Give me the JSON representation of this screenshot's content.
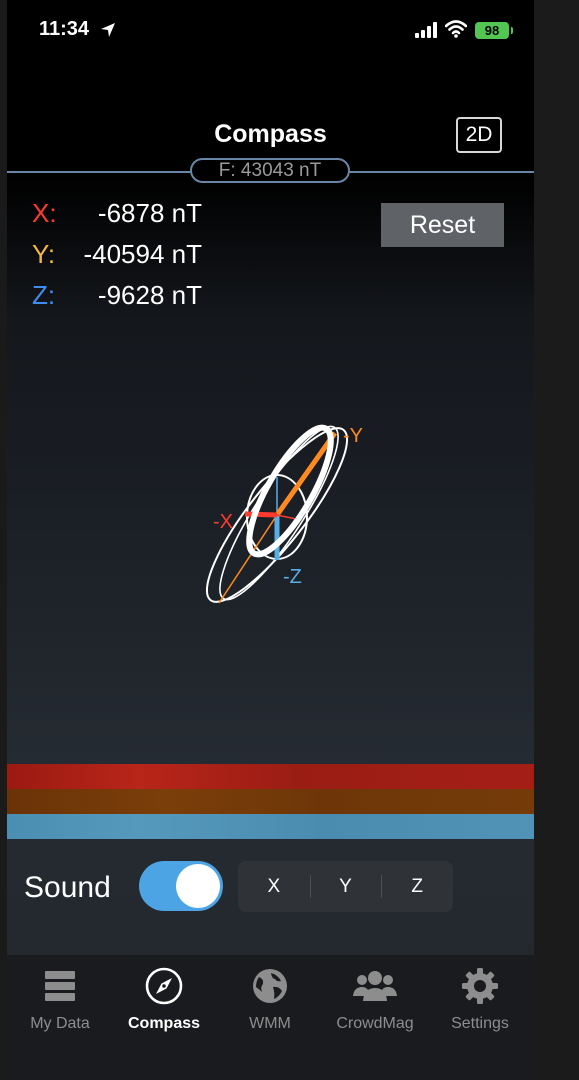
{
  "status": {
    "time": "11:34",
    "battery": "98"
  },
  "header": {
    "title": "Compass",
    "mode_button": "2D",
    "field_total": "F: 43043 nT"
  },
  "readings": [
    {
      "axis": "X:",
      "value": "-6878 nT",
      "color": "#ff3b30"
    },
    {
      "axis": "Y:",
      "value": "-40594 nT",
      "color": "#f5b83d"
    },
    {
      "axis": "Z:",
      "value": "-9628 nT",
      "color": "#3d8ef0"
    }
  ],
  "reset_button": "Reset",
  "viz": {
    "x_label": "-X",
    "y_label": "-Y",
    "z_label": "-Z",
    "x_color": "#ff3b30",
    "y_color": "#ff8a1f",
    "z_color": "#5aaee6"
  },
  "sound": {
    "label": "Sound",
    "enabled": true,
    "axes": [
      "X",
      "Y",
      "Z"
    ]
  },
  "tabs": [
    {
      "label": "My Data",
      "icon": "server-icon",
      "active": false
    },
    {
      "label": "Compass",
      "icon": "compass-icon",
      "active": true
    },
    {
      "label": "WMM",
      "icon": "globe-icon",
      "active": false
    },
    {
      "label": "CrowdMag",
      "icon": "group-icon",
      "active": false
    },
    {
      "label": "Settings",
      "icon": "gear-icon",
      "active": false
    }
  ]
}
